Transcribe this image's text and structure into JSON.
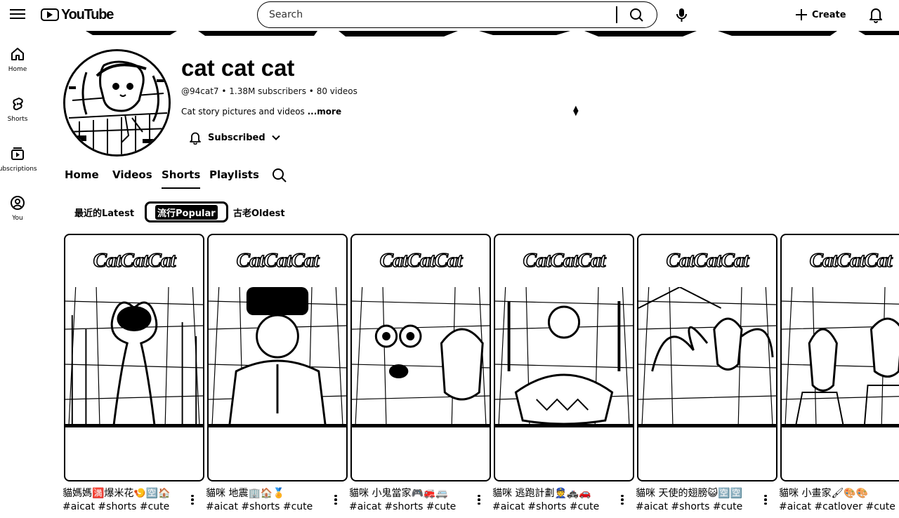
{
  "header": {
    "logo_text": "YouTube",
    "search_placeholder": "Search",
    "create_label": "Create"
  },
  "rail": {
    "items": [
      {
        "label": "Home",
        "icon": "home-icon"
      },
      {
        "label": "Shorts",
        "icon": "shorts-icon"
      },
      {
        "label": "Subscriptions",
        "icon": "subscriptions-icon"
      },
      {
        "label": "You",
        "icon": "you-icon"
      }
    ]
  },
  "channel": {
    "title": "cat cat cat",
    "handle": "@94cat7",
    "subscribers": "1.38M subscribers",
    "videos": "80 videos",
    "description": "Cat story pictures and videos ",
    "more_label": "...more",
    "subscribe_label": "Subscribed"
  },
  "tabs": [
    {
      "label": "Home",
      "active": false
    },
    {
      "label": "Videos",
      "active": false
    },
    {
      "label": "Shorts",
      "active": true
    },
    {
      "label": "Playlists",
      "active": false
    }
  ],
  "chips": [
    {
      "label": "最近的Latest",
      "active": false
    },
    {
      "label": "流行Popular",
      "active": true
    },
    {
      "label": "古老Oldest",
      "active": false
    }
  ],
  "shorts": [
    {
      "thumb_text": "CatCatCat",
      "title_line1": "貓媽媽🈵爆米花🍤🈳🏠",
      "title_line2": "#aicat #shorts #cute"
    },
    {
      "thumb_text": "CatCatCat",
      "title_line1": "貓咪 地震🏢🏠🏅",
      "title_line2": "#aicat #shorts #cute"
    },
    {
      "thumb_text": "CatCatCat",
      "title_line1": "貓咪 小鬼當家🎮🚒🚐",
      "title_line2": "#aicat #shorts #cute"
    },
    {
      "thumb_text": "CatCatCat",
      "title_line1": "貓咪 逃跑計劃👮🚓🚗",
      "title_line2": "#aicat #shorts #cute"
    },
    {
      "thumb_text": "CatCatCat",
      "title_line1": "貓咪 天使的翅膀😺🈳🈳",
      "title_line2": "#aicat #shorts #cute"
    },
    {
      "thumb_text": "CatCatCat",
      "title_line1": "貓咪 小畫家🖌🎨🎨",
      "title_line2": "#aicat #catlover #cute"
    }
  ]
}
